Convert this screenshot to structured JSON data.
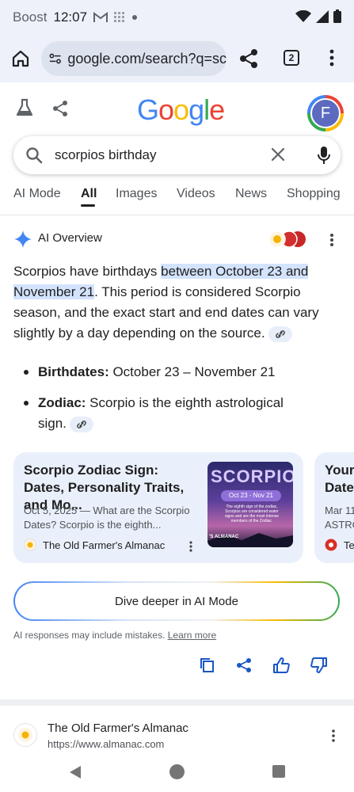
{
  "status": {
    "carrier": "Boost",
    "time": "12:07"
  },
  "browser": {
    "url": "google.com/search?q=sc",
    "tab_count": "2"
  },
  "header": {
    "logo": [
      "G",
      "o",
      "o",
      "g",
      "l",
      "e"
    ],
    "logo_colors": [
      "#4285f4",
      "#ea4335",
      "#fbbc05",
      "#4285f4",
      "#34a853",
      "#ea4335"
    ],
    "avatar_letter": "F"
  },
  "search": {
    "query": "scorpios birthday"
  },
  "tabs": [
    "AI Mode",
    "All",
    "Images",
    "Videos",
    "News",
    "Shopping"
  ],
  "ai_overview": {
    "title": "AI Overview",
    "answer_before": "Scorpios have birthdays ",
    "answer_highlight": "between October 23 and November 21",
    "answer_after": ". This period is considered Scorpio season, and the exact start and end dates can vary slightly by a day depending on the source.",
    "bullets": [
      {
        "label": "Birthdates:",
        "text": " October 23 – November 21"
      },
      {
        "label": "Zodiac:",
        "text": " Scorpio is the eighth astrological sign."
      }
    ]
  },
  "card": {
    "title": "Scorpio Zodiac Sign: Dates, Personality Traits, and Mo...",
    "snippet": "Oct 5, 2025 — What are the Scorpio Dates? Scorpio is the eighth...",
    "source": "The Old Farmer's Almanac",
    "image_heading": "SCORPIO",
    "image_dates": "Oct 23 - Nov 21",
    "image_text": "The eighth sign of the zodiac, Scorpios are considered water signs and are the most intense members of the Zodiac.",
    "image_brand": "'S ALMANAC"
  },
  "card2": {
    "title_line1": "Your",
    "title_line2": "Date",
    "snippet_line1": "Mar 11",
    "snippet_line2": "ASTRO",
    "source": "Te"
  },
  "dive_deeper": "Dive deeper in AI Mode",
  "disclaimer": {
    "text": "AI responses may include mistakes. ",
    "link": "Learn more"
  },
  "result": {
    "site": "The Old Farmer's Almanac",
    "url": "https://www.almanac.com"
  }
}
